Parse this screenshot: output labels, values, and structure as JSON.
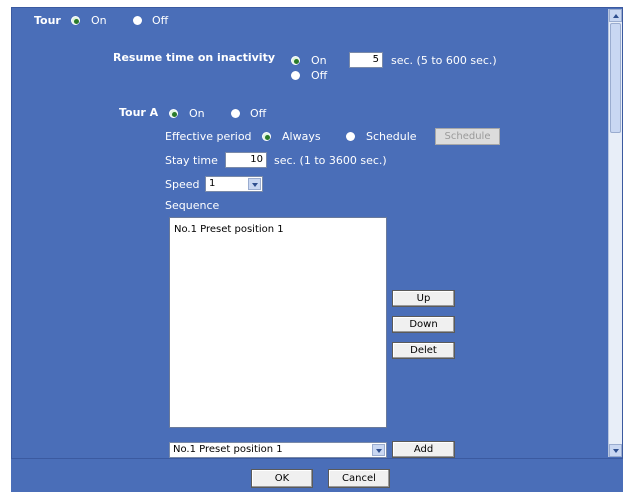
{
  "tour": {
    "label": "Tour",
    "on": "On",
    "off": "Off"
  },
  "resume": {
    "label": "Resume time on inactivity",
    "on": "On",
    "off": "Off",
    "value": "5",
    "range": "sec. (5 to 600 sec.)"
  },
  "tour_a": {
    "label": "Tour A",
    "on": "On",
    "off": "Off",
    "effective_period": {
      "label": "Effective period",
      "always": "Always",
      "schedule": "Schedule",
      "schedule_button": "Schedule"
    },
    "stay_time": {
      "label": "Stay time",
      "value": "10",
      "range": "sec. (1 to 3600 sec.)"
    },
    "speed": {
      "label": "Speed",
      "value": "1"
    },
    "sequence": {
      "label": "Sequence",
      "items": [
        "No.1 Preset position 1"
      ]
    },
    "buttons": {
      "up": "Up",
      "down": "Down",
      "delete": "Delet",
      "add": "Add"
    },
    "preset_select": "No.1 Preset position 1"
  },
  "footer": {
    "ok": "OK",
    "cancel": "Cancel"
  }
}
